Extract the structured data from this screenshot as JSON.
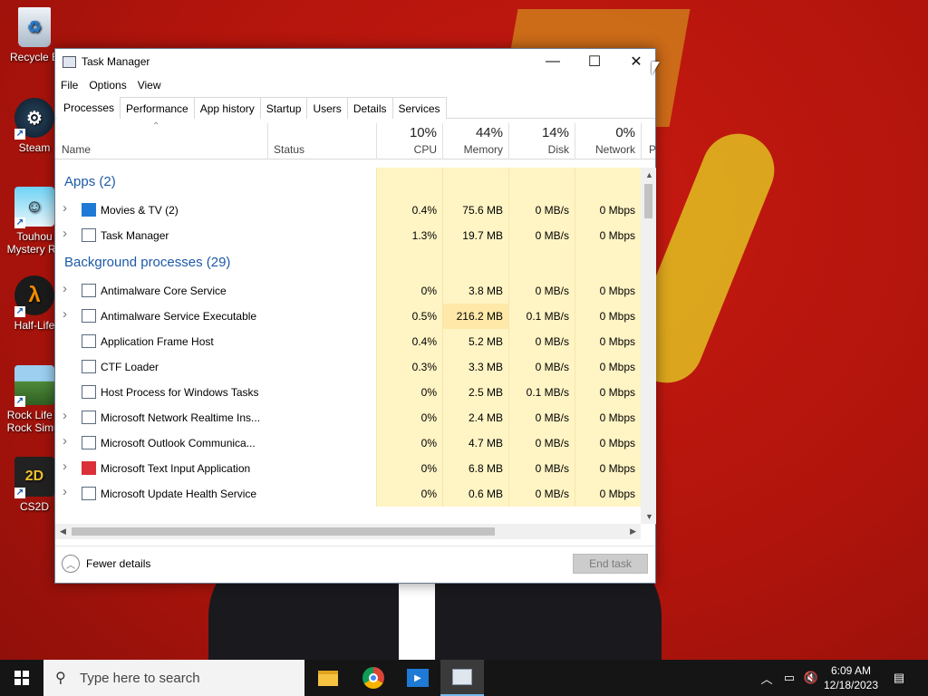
{
  "desktop": {
    "icons": [
      {
        "label": "Recycle B",
        "icon": "recycle-bin-icon"
      },
      {
        "label": "Steam",
        "icon": "steam-icon"
      },
      {
        "label": "Touhou",
        "label2": "Mystery Re",
        "icon": "touhou-icon"
      },
      {
        "label": "Half-Life",
        "icon": "half-life-icon"
      },
      {
        "label": "Rock Life T",
        "label2": "Rock Simul",
        "icon": "rock-life-icon"
      },
      {
        "label": "CS2D",
        "icon": "cs2d-icon"
      }
    ]
  },
  "window": {
    "title": "Task Manager",
    "controls": {
      "minimize": "—",
      "maximize": "☐",
      "close": "✕"
    }
  },
  "menu": {
    "file": "File",
    "options": "Options",
    "view": "View"
  },
  "tabs": [
    "Processes",
    "Performance",
    "App history",
    "Startup",
    "Users",
    "Details",
    "Services"
  ],
  "columns": {
    "name": "Name",
    "status": "Status",
    "cpu": {
      "pct": "10%",
      "label": "CPU"
    },
    "memory": {
      "pct": "44%",
      "label": "Memory"
    },
    "disk": {
      "pct": "14%",
      "label": "Disk"
    },
    "network": {
      "pct": "0%",
      "label": "Network"
    },
    "power": "P"
  },
  "groups": {
    "apps": "Apps (2)",
    "background": "Background processes (29)"
  },
  "apps": [
    {
      "name": "Movies & TV (2)",
      "cpu": "0.4%",
      "memory": "75.6 MB",
      "disk": "0 MB/s",
      "network": "0 Mbps"
    },
    {
      "name": "Task Manager",
      "cpu": "1.3%",
      "memory": "19.7 MB",
      "disk": "0 MB/s",
      "network": "0 Mbps"
    }
  ],
  "background": [
    {
      "name": "Antimalware Core Service",
      "cpu": "0%",
      "memory": "3.8 MB",
      "disk": "0 MB/s",
      "network": "0 Mbps"
    },
    {
      "name": "Antimalware Service Executable",
      "cpu": "0.5%",
      "memory": "216.2 MB",
      "disk": "0.1 MB/s",
      "network": "0 Mbps"
    },
    {
      "name": "Application Frame Host",
      "cpu": "0.4%",
      "memory": "5.2 MB",
      "disk": "0 MB/s",
      "network": "0 Mbps"
    },
    {
      "name": "CTF Loader",
      "cpu": "0.3%",
      "memory": "3.3 MB",
      "disk": "0 MB/s",
      "network": "0 Mbps"
    },
    {
      "name": "Host Process for Windows Tasks",
      "cpu": "0%",
      "memory": "2.5 MB",
      "disk": "0.1 MB/s",
      "network": "0 Mbps"
    },
    {
      "name": "Microsoft Network Realtime Ins...",
      "cpu": "0%",
      "memory": "2.4 MB",
      "disk": "0 MB/s",
      "network": "0 Mbps"
    },
    {
      "name": "Microsoft Outlook Communica...",
      "cpu": "0%",
      "memory": "4.7 MB",
      "disk": "0 MB/s",
      "network": "0 Mbps"
    },
    {
      "name": "Microsoft Text Input Application",
      "cpu": "0%",
      "memory": "6.8 MB",
      "disk": "0 MB/s",
      "network": "0 Mbps"
    },
    {
      "name": "Microsoft Update Health Service",
      "cpu": "0%",
      "memory": "0.6 MB",
      "disk": "0 MB/s",
      "network": "0 Mbps"
    }
  ],
  "footer": {
    "fewer_details": "Fewer details",
    "end_task": "End task"
  },
  "taskbar": {
    "search_placeholder": "Type here to search",
    "time": "6:09 AM",
    "date": "12/18/2023"
  }
}
